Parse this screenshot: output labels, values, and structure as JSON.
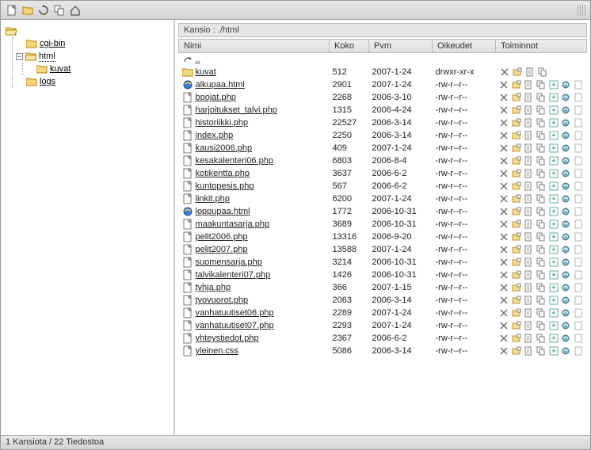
{
  "toolbar": {
    "icons": [
      "new-file",
      "new-folder",
      "refresh",
      "copy-move",
      "home"
    ]
  },
  "tree": {
    "root": {
      "label": ""
    },
    "items": [
      {
        "label": "cgi-bin",
        "expandable": false
      },
      {
        "label": "html",
        "expandable": true,
        "expanded": true,
        "selected": true,
        "children": [
          {
            "label": "kuvat"
          }
        ]
      },
      {
        "label": "logs",
        "expandable": false
      }
    ]
  },
  "path": {
    "prefix": "Kansio : ",
    "value": "./html"
  },
  "columns": {
    "name": "Nimi",
    "size": "Koko",
    "date": "Pvm",
    "perm": "Oikeudet",
    "actions": "Toiminnot"
  },
  "up_label": "..",
  "files": [
    {
      "icon": "folder",
      "name": "kuvat",
      "size": "512",
      "date": "2007-1-24",
      "perm": "drwxr-xr-x",
      "type": "dir"
    },
    {
      "icon": "ie",
      "name": "alkupaa.html",
      "size": "2901",
      "date": "2007-1-24",
      "perm": "-rw-r--r--",
      "type": "html"
    },
    {
      "icon": "file",
      "name": "bpojat.php",
      "size": "2268",
      "date": "2006-3-10",
      "perm": "-rw-r--r--",
      "type": "file"
    },
    {
      "icon": "file",
      "name": "harjoitukset_talvi.php",
      "size": "1315",
      "date": "2006-4-24",
      "perm": "-rw-r--r--",
      "type": "file"
    },
    {
      "icon": "file",
      "name": "historiikki.php",
      "size": "22527",
      "date": "2006-3-14",
      "perm": "-rw-r--r--",
      "type": "file"
    },
    {
      "icon": "file",
      "name": "index.php",
      "size": "2250",
      "date": "2006-3-14",
      "perm": "-rw-r--r--",
      "type": "file"
    },
    {
      "icon": "file",
      "name": "kausi2006.php",
      "size": "409",
      "date": "2007-1-24",
      "perm": "-rw-r--r--",
      "type": "file"
    },
    {
      "icon": "file",
      "name": "kesakalenteri06.php",
      "size": "6803",
      "date": "2006-8-4",
      "perm": "-rw-r--r--",
      "type": "file"
    },
    {
      "icon": "file",
      "name": "kotikentta.php",
      "size": "3637",
      "date": "2006-6-2",
      "perm": "-rw-r--r--",
      "type": "file"
    },
    {
      "icon": "file",
      "name": "kuntopesis.php",
      "size": "567",
      "date": "2006-6-2",
      "perm": "-rw-r--r--",
      "type": "file"
    },
    {
      "icon": "file",
      "name": "linkit.php",
      "size": "6200",
      "date": "2007-1-24",
      "perm": "-rw-r--r--",
      "type": "file"
    },
    {
      "icon": "ie",
      "name": "loppupaa.html",
      "size": "1772",
      "date": "2006-10-31",
      "perm": "-rw-r--r--",
      "type": "html"
    },
    {
      "icon": "file",
      "name": "maakuntasarja.php",
      "size": "3689",
      "date": "2006-10-31",
      "perm": "-rw-r--r--",
      "type": "file"
    },
    {
      "icon": "file",
      "name": "pelit2006.php",
      "size": "13316",
      "date": "2006-9-20",
      "perm": "-rw-r--r--",
      "type": "file"
    },
    {
      "icon": "file",
      "name": "pelit2007.php",
      "size": "13588",
      "date": "2007-1-24",
      "perm": "-rw-r--r--",
      "type": "file"
    },
    {
      "icon": "file",
      "name": "suomensarja.php",
      "size": "3214",
      "date": "2006-10-31",
      "perm": "-rw-r--r--",
      "type": "file"
    },
    {
      "icon": "file",
      "name": "talvikalenteri07.php",
      "size": "1426",
      "date": "2006-10-31",
      "perm": "-rw-r--r--",
      "type": "file"
    },
    {
      "icon": "file",
      "name": "tyhja.php",
      "size": "366",
      "date": "2007-1-15",
      "perm": "-rw-r--r--",
      "type": "file"
    },
    {
      "icon": "file",
      "name": "tyovuorot.php",
      "size": "2063",
      "date": "2006-3-14",
      "perm": "-rw-r--r--",
      "type": "file"
    },
    {
      "icon": "file",
      "name": "vanhatuutiset06.php",
      "size": "2289",
      "date": "2007-1-24",
      "perm": "-rw-r--r--",
      "type": "file"
    },
    {
      "icon": "file",
      "name": "vanhatuutiset07.php",
      "size": "2293",
      "date": "2007-1-24",
      "perm": "-rw-r--r--",
      "type": "file"
    },
    {
      "icon": "file",
      "name": "yhteystiedot.php",
      "size": "2367",
      "date": "2006-6-2",
      "perm": "-rw-r--r--",
      "type": "file"
    },
    {
      "icon": "file",
      "name": "yleinen.css",
      "size": "5086",
      "date": "2006-3-14",
      "perm": "-rw-r--r--",
      "type": "file"
    }
  ],
  "status": "1 Kansiota / 22 Tiedostoa",
  "icons": {
    "folder_open": "folder-open-icon",
    "folder": "folder-icon",
    "file": "file-icon",
    "ie": "ie-icon",
    "up": "up-icon"
  }
}
